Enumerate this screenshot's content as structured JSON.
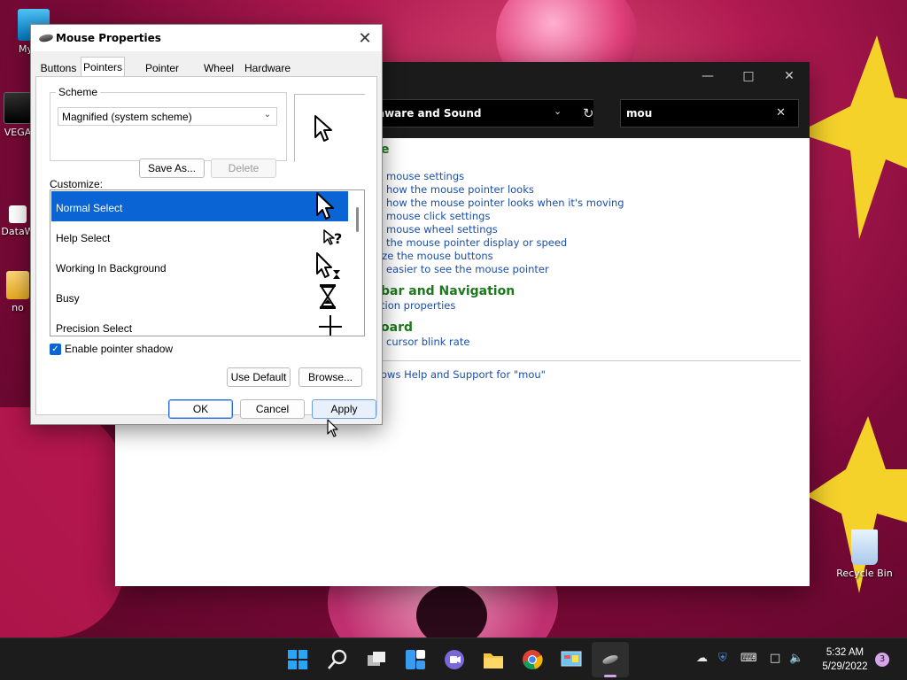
{
  "desktop": {
    "icons": [
      {
        "label": "My Co"
      },
      {
        "label": "VEGA"
      },
      {
        "label": "DataW"
      },
      {
        "label": "no"
      },
      {
        "label": "Recycle Bin"
      }
    ]
  },
  "control_panel": {
    "address_text": "aware and Sound",
    "search_text": "mou",
    "sections": [
      {
        "heading": "e",
        "links": [
          "mouse settings",
          "how the mouse pointer looks",
          "how the mouse pointer looks when it's moving",
          "mouse click settings",
          "mouse wheel settings",
          "the mouse pointer display or speed",
          "ize the mouse buttons",
          "easier to see the mouse pointer"
        ]
      },
      {
        "heading": "bar and Navigation",
        "links": [
          "tion properties"
        ]
      },
      {
        "heading": "oard",
        "links": [
          "cursor blink rate"
        ]
      }
    ],
    "help_link": "ows Help and Support for \"mou\""
  },
  "dialog": {
    "title": "Mouse Properties",
    "tabs": [
      "Buttons",
      "Pointers",
      "Pointer Options",
      "Wheel",
      "Hardware"
    ],
    "active_tab": "Pointers",
    "scheme_label": "Scheme",
    "scheme_value": "Magnified (system scheme)",
    "save_as_label": "Save As...",
    "delete_label": "Delete",
    "customize_label": "Customize:",
    "cursor_items": [
      {
        "label": "Normal Select",
        "icon": "arrow-cursor-icon",
        "selected": true
      },
      {
        "label": "Help Select",
        "icon": "help-cursor-icon"
      },
      {
        "label": "Working In Background",
        "icon": "working-cursor-icon"
      },
      {
        "label": "Busy",
        "icon": "hourglass-cursor-icon"
      },
      {
        "label": "Precision Select",
        "icon": "crosshair-cursor-icon"
      }
    ],
    "enable_shadow_label": "Enable pointer shadow",
    "enable_shadow_checked": true,
    "use_default_label": "Use Default",
    "browse_label": "Browse...",
    "ok_label": "OK",
    "cancel_label": "Cancel",
    "apply_label": "Apply"
  },
  "taskbar": {
    "time": "5:32 AM",
    "date": "5/29/2022",
    "notification_count": "3",
    "apps": [
      "start-icon",
      "search-icon",
      "task-view-icon",
      "widgets-icon",
      "teams-chat-icon",
      "file-explorer-icon",
      "chrome-icon",
      "control-panel-icon",
      "mouse-properties-icon"
    ]
  },
  "colors": {
    "selection": "#0a64d4",
    "link": "#1a4faa",
    "heading_green": "#1c7a1c",
    "taskbar": "#1c1c1c"
  }
}
